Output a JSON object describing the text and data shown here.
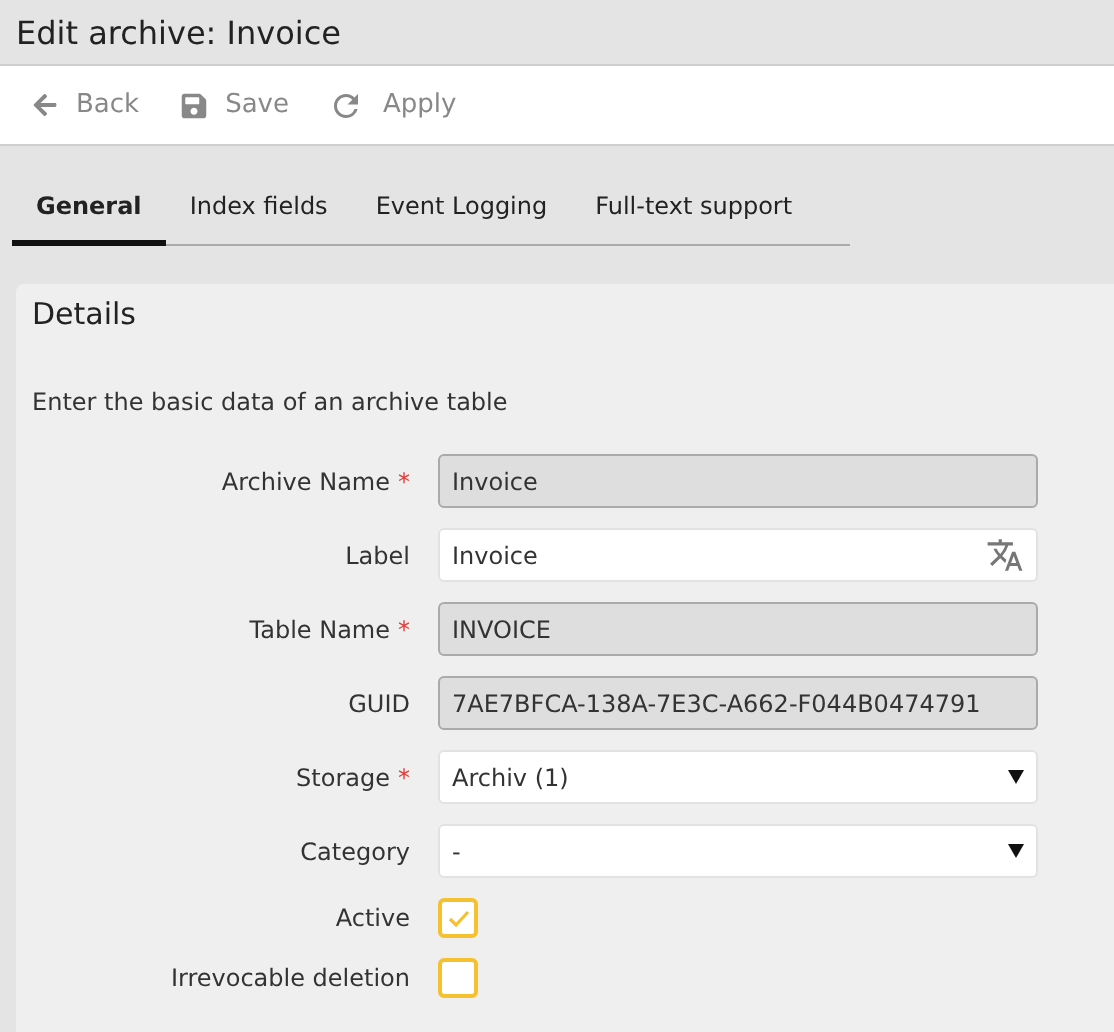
{
  "window": {
    "title": "Edit archive: Invoice"
  },
  "toolbar": [
    {
      "label": "Back",
      "kind": "back"
    },
    {
      "label": "Save",
      "kind": "save"
    },
    {
      "label": "Apply",
      "kind": "apply"
    }
  ],
  "tabs": [
    {
      "label": "General",
      "selected": true
    },
    {
      "label": "Index fields",
      "selected": false
    },
    {
      "label": "Event Logging",
      "selected": false
    },
    {
      "label": "Full-text support",
      "selected": false
    }
  ],
  "panel": {
    "title": "Details",
    "description": "Enter the basic data of an archive table",
    "fields": [
      {
        "label": "Archive Name",
        "required_mark": "*",
        "kind": "readonly",
        "value": "Invoice"
      },
      {
        "label": "Label",
        "kind": "translatable",
        "value": "Invoice"
      },
      {
        "label": "Table Name",
        "required_mark": "*",
        "kind": "readonly",
        "value": "INVOICE"
      },
      {
        "label": "GUID",
        "kind": "readonly",
        "value": "7AE7BFCA-138A-7E3C-A662-F044B0474791"
      },
      {
        "label": "Storage",
        "required_mark": "*",
        "kind": "select",
        "value": "Archiv (1)"
      },
      {
        "label": "Category",
        "kind": "select",
        "value": "-"
      },
      {
        "label": "Active",
        "kind": "checkbox",
        "checked": true
      },
      {
        "label": "Irrevocable deletion",
        "kind": "checkbox",
        "checked": false
      }
    ]
  }
}
